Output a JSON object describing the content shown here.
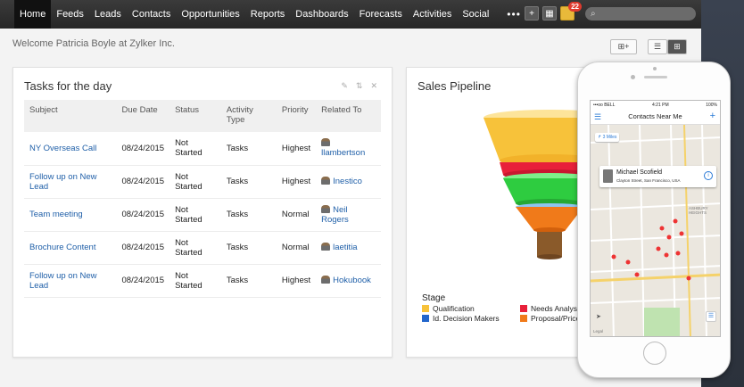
{
  "nav": {
    "items": [
      "Home",
      "Feeds",
      "Leads",
      "Contacts",
      "Opportunities",
      "Reports",
      "Dashboards",
      "Forecasts",
      "Activities",
      "Social"
    ],
    "more": "•••",
    "active_index": 0
  },
  "header": {
    "notifications_count": "22",
    "search_icon": "search-icon"
  },
  "welcome": "Welcome Patricia Boyle at Zylker Inc.",
  "tasks_panel": {
    "title": "Tasks for the day",
    "columns": [
      "Subject",
      "Due Date",
      "Status",
      "Activity Type",
      "Priority",
      "Related To"
    ],
    "rows": [
      {
        "subject": "NY Overseas Call",
        "due": "08/24/2015",
        "status": "Not Started",
        "type": "Tasks",
        "priority": "Highest",
        "related": "llambertson"
      },
      {
        "subject": "Follow up on New Lead",
        "due": "08/24/2015",
        "status": "Not Started",
        "type": "Tasks",
        "priority": "Highest",
        "related": "Inestico"
      },
      {
        "subject": "Team meeting",
        "due": "08/24/2015",
        "status": "Not Started",
        "type": "Tasks",
        "priority": "Normal",
        "related": "Neil Rogers"
      },
      {
        "subject": "Brochure Content",
        "due": "08/24/2015",
        "status": "Not Started",
        "type": "Tasks",
        "priority": "Normal",
        "related": "laetitia"
      },
      {
        "subject": "Follow up on New Lead",
        "due": "08/24/2015",
        "status": "Not Started",
        "type": "Tasks",
        "priority": "Highest",
        "related": "Hokubook"
      }
    ]
  },
  "pipeline_panel": {
    "title": "Sales Pipeline",
    "legend_title": "Stage",
    "legend": [
      {
        "label": "Qualification",
        "color": "#f7c23a"
      },
      {
        "label": "Needs Analysis",
        "color": "#e8203a"
      },
      {
        "label": "Id. Decision Makers",
        "color": "#2266cc"
      },
      {
        "label": "Proposal/Price Q",
        "color": "#f07a1a"
      }
    ],
    "funnel_colors": [
      "#f7c23a",
      "#e8203a",
      "#2ecc40",
      "#f07a1a",
      "#8a5a2a"
    ]
  },
  "phone": {
    "status_carrier": "•••oo BELL",
    "status_time": "4:21 PM",
    "status_battery": "100%",
    "header_title": "Contacts Near Me",
    "miles": "3 Miles",
    "contact_name": "Michael Scofield",
    "contact_address": "Clayton Street, San Francisco, USA",
    "map_labels": [
      "ASHBURY HEIGHTS",
      "Legal"
    ]
  }
}
